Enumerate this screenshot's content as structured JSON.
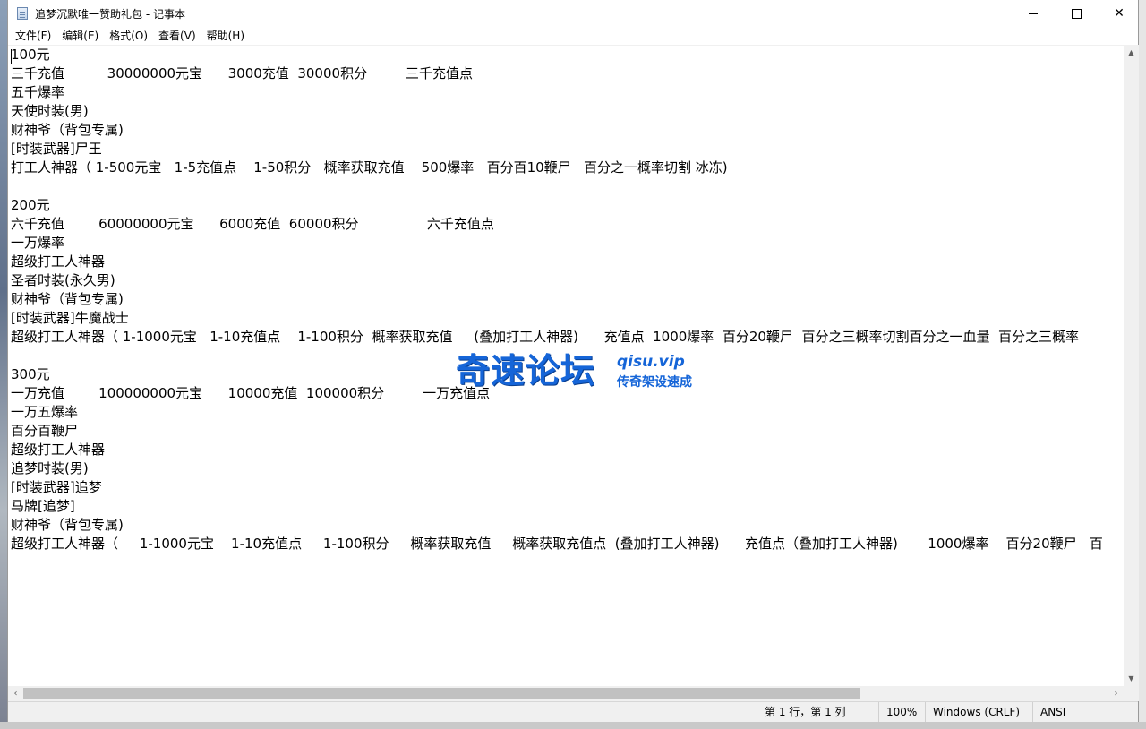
{
  "window": {
    "title": "追梦沉默唯一赞助礼包 - 记事本",
    "controls": {
      "minimize": "—",
      "maximize": "☐",
      "close": "✕"
    }
  },
  "menu": [
    "文件(F)",
    "编辑(E)",
    "格式(O)",
    "查看(V)",
    "帮助(H)"
  ],
  "content": [
    "100元",
    "三千充值          30000000元宝      3000充值  30000积分         三千充值点",
    "五千爆率",
    "天使时装(男)",
    "财神爷（背包专属)",
    "[时装武器]尸王",
    "打工人神器（ 1-500元宝   1-5充值点    1-50积分   概率获取充值    500爆率   百分百10鞭尸   百分之一概率切割 冰冻)",
    "",
    "200元",
    "六千充值        60000000元宝      6000充值  60000积分                六千充值点",
    "一万爆率",
    "超级打工人神器",
    "圣者时装(永久男)",
    "财神爷（背包专属)",
    "[时装武器]牛魔战士",
    "超级打工人神器（ 1-1000元宝   1-10充值点    1-100积分  概率获取充值     (叠加打工人神器)      充值点  1000爆率  百分20鞭尸  百分之三概率切割百分之一血量  百分之三概率",
    "",
    "300元",
    "一万充值        100000000元宝      10000充值  100000积分         一万充值点",
    "一万五爆率",
    "百分百鞭尸",
    "超级打工人神器",
    "追梦时装(男)",
    "[时装武器]追梦",
    "马牌[追梦]",
    "财神爷（背包专属)",
    "超级打工人神器（     1-1000元宝    1-10充值点     1-100积分     概率获取充值     概率获取充值点  (叠加打工人神器)      充值点（叠加打工人神器)       1000爆率    百分20鞭尸   百"
  ],
  "status": {
    "position": "第 1 行，第 1 列",
    "zoom": "100%",
    "line_ending": "Windows (CRLF)",
    "encoding": "ANSI"
  },
  "watermark": {
    "name": "奇速论坛",
    "domain": "qisu.vip",
    "slogan": "传奇架设速成"
  }
}
